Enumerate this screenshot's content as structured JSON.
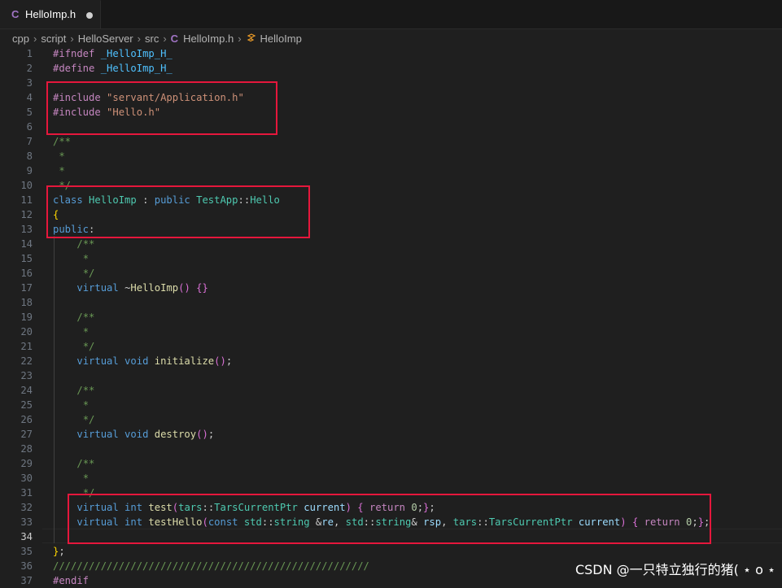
{
  "tab": {
    "icon": "C",
    "label": "HelloImp.h"
  },
  "breadcrumb": {
    "items": [
      "cpp",
      "script",
      "HelloServer",
      "src"
    ],
    "file_icon": "C",
    "file": "HelloImp.h",
    "symbol": "HelloImp"
  },
  "lines": [
    {
      "n": "1",
      "tokens": [
        [
          "pp",
          "#ifndef "
        ],
        [
          "mac",
          "_HelloImp_H_"
        ]
      ]
    },
    {
      "n": "2",
      "tokens": [
        [
          "pp",
          "#define "
        ],
        [
          "mac",
          "_HelloImp_H_"
        ]
      ]
    },
    {
      "n": "3",
      "tokens": []
    },
    {
      "n": "4",
      "tokens": [
        [
          "pp",
          "#include "
        ],
        [
          "str",
          "\"servant/Application.h\""
        ]
      ]
    },
    {
      "n": "5",
      "tokens": [
        [
          "pp",
          "#include "
        ],
        [
          "str",
          "\"Hello.h\""
        ]
      ]
    },
    {
      "n": "6",
      "tokens": []
    },
    {
      "n": "7",
      "tokens": [
        [
          "cm",
          "/**"
        ]
      ]
    },
    {
      "n": "8",
      "tokens": [
        [
          "cm",
          " *"
        ]
      ]
    },
    {
      "n": "9",
      "tokens": [
        [
          "cm",
          " *"
        ]
      ]
    },
    {
      "n": "10",
      "tokens": [
        [
          "cm",
          " */"
        ]
      ]
    },
    {
      "n": "11",
      "tokens": [
        [
          "kw",
          "class "
        ],
        [
          "ty",
          "HelloImp"
        ],
        [
          "plain",
          " : "
        ],
        [
          "kw",
          "public "
        ],
        [
          "ty",
          "TestApp"
        ],
        [
          "plain",
          "::"
        ],
        [
          "ty",
          "Hello"
        ]
      ]
    },
    {
      "n": "12",
      "tokens": [
        [
          "br1",
          "{"
        ]
      ]
    },
    {
      "n": "13",
      "tokens": [
        [
          "kw",
          "public"
        ],
        [
          "plain",
          ":"
        ]
      ]
    },
    {
      "n": "14",
      "tokens": [
        [
          "plain",
          "    "
        ],
        [
          "cm",
          "/**"
        ]
      ]
    },
    {
      "n": "15",
      "tokens": [
        [
          "plain",
          "    "
        ],
        [
          "cm",
          " *"
        ]
      ]
    },
    {
      "n": "16",
      "tokens": [
        [
          "plain",
          "    "
        ],
        [
          "cm",
          " */"
        ]
      ]
    },
    {
      "n": "17",
      "tokens": [
        [
          "plain",
          "    "
        ],
        [
          "kw",
          "virtual "
        ],
        [
          "plain",
          "~"
        ],
        [
          "fn",
          "HelloImp"
        ],
        [
          "br2",
          "()"
        ],
        [
          "plain",
          " "
        ],
        [
          "br2",
          "{}"
        ]
      ]
    },
    {
      "n": "18",
      "tokens": []
    },
    {
      "n": "19",
      "tokens": [
        [
          "plain",
          "    "
        ],
        [
          "cm",
          "/**"
        ]
      ]
    },
    {
      "n": "20",
      "tokens": [
        [
          "plain",
          "    "
        ],
        [
          "cm",
          " *"
        ]
      ]
    },
    {
      "n": "21",
      "tokens": [
        [
          "plain",
          "    "
        ],
        [
          "cm",
          " */"
        ]
      ]
    },
    {
      "n": "22",
      "tokens": [
        [
          "plain",
          "    "
        ],
        [
          "kw",
          "virtual void "
        ],
        [
          "fn",
          "initialize"
        ],
        [
          "br2",
          "()"
        ],
        [
          "plain",
          ";"
        ]
      ]
    },
    {
      "n": "23",
      "tokens": []
    },
    {
      "n": "24",
      "tokens": [
        [
          "plain",
          "    "
        ],
        [
          "cm",
          "/**"
        ]
      ]
    },
    {
      "n": "25",
      "tokens": [
        [
          "plain",
          "    "
        ],
        [
          "cm",
          " *"
        ]
      ]
    },
    {
      "n": "26",
      "tokens": [
        [
          "plain",
          "    "
        ],
        [
          "cm",
          " */"
        ]
      ]
    },
    {
      "n": "27",
      "tokens": [
        [
          "plain",
          "    "
        ],
        [
          "kw",
          "virtual void "
        ],
        [
          "fn",
          "destroy"
        ],
        [
          "br2",
          "()"
        ],
        [
          "plain",
          ";"
        ]
      ]
    },
    {
      "n": "28",
      "tokens": []
    },
    {
      "n": "29",
      "tokens": [
        [
          "plain",
          "    "
        ],
        [
          "cm",
          "/**"
        ]
      ]
    },
    {
      "n": "30",
      "tokens": [
        [
          "plain",
          "    "
        ],
        [
          "cm",
          " *"
        ]
      ]
    },
    {
      "n": "31",
      "tokens": [
        [
          "plain",
          "    "
        ],
        [
          "cm",
          " */"
        ]
      ]
    },
    {
      "n": "32",
      "tokens": [
        [
          "plain",
          "    "
        ],
        [
          "kw",
          "virtual int "
        ],
        [
          "fn",
          "test"
        ],
        [
          "br2",
          "("
        ],
        [
          "ty",
          "tars"
        ],
        [
          "plain",
          "::"
        ],
        [
          "ty",
          "TarsCurrentPtr "
        ],
        [
          "var",
          "current"
        ],
        [
          "br2",
          ")"
        ],
        [
          "plain",
          " "
        ],
        [
          "br2",
          "{"
        ],
        [
          "plain",
          " "
        ],
        [
          "ctl",
          "return "
        ],
        [
          "num",
          "0"
        ],
        [
          "plain",
          ";"
        ],
        [
          "br2",
          "}"
        ],
        [
          "plain",
          ";"
        ]
      ]
    },
    {
      "n": "33",
      "tokens": [
        [
          "plain",
          "    "
        ],
        [
          "kw",
          "virtual int "
        ],
        [
          "fn",
          "testHello"
        ],
        [
          "br2",
          "("
        ],
        [
          "kw",
          "const "
        ],
        [
          "ty",
          "std"
        ],
        [
          "plain",
          "::"
        ],
        [
          "ty",
          "string "
        ],
        [
          "plain",
          "&"
        ],
        [
          "var",
          "re"
        ],
        [
          "plain",
          ", "
        ],
        [
          "ty",
          "std"
        ],
        [
          "plain",
          "::"
        ],
        [
          "ty",
          "string"
        ],
        [
          "plain",
          "& "
        ],
        [
          "var",
          "rsp"
        ],
        [
          "plain",
          ", "
        ],
        [
          "ty",
          "tars"
        ],
        [
          "plain",
          "::"
        ],
        [
          "ty",
          "TarsCurrentPtr "
        ],
        [
          "var",
          "current"
        ],
        [
          "br2",
          ")"
        ],
        [
          "plain",
          " "
        ],
        [
          "br2",
          "{"
        ],
        [
          "plain",
          " "
        ],
        [
          "ctl",
          "return "
        ],
        [
          "num",
          "0"
        ],
        [
          "plain",
          ";"
        ],
        [
          "br2",
          "}"
        ],
        [
          "plain",
          ";"
        ]
      ]
    },
    {
      "n": "34",
      "tokens": []
    },
    {
      "n": "35",
      "tokens": [
        [
          "br1",
          "}"
        ],
        [
          "plain",
          ";"
        ]
      ]
    },
    {
      "n": "36",
      "tokens": [
        [
          "cm",
          "/////////////////////////////////////////////////////"
        ]
      ]
    },
    {
      "n": "37",
      "tokens": [
        [
          "pp",
          "#endif"
        ]
      ]
    }
  ],
  "current_line": "34",
  "watermark": "CSDN @一只特立独行的猪( ⋆ ο ⋆",
  "colors": {
    "highlight_box": "#e5173c",
    "background": "#1f1f1f"
  }
}
